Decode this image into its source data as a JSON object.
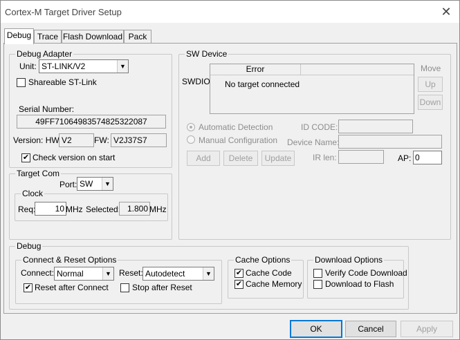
{
  "window": {
    "title": "Cortex-M Target Driver Setup",
    "close_glyph": "✕"
  },
  "tabs": [
    {
      "label": "Debug",
      "active": true
    },
    {
      "label": "Trace"
    },
    {
      "label": "Flash Download"
    },
    {
      "label": "Pack"
    }
  ],
  "debug_adapter": {
    "group_label": "Debug Adapter",
    "unit_label": "Unit:",
    "unit_value": "ST-LINK/V2",
    "shareable_label": "Shareable ST-Link",
    "shareable_checked": false,
    "serial_label": "Serial Number:",
    "serial_value": "49FF71064983574825322087",
    "version_label": "Version: HW:",
    "hw_value": "V2",
    "fw_label": "FW:",
    "fw_value": "V2J37S7",
    "check_version_label": "Check version on start",
    "check_version_checked": true
  },
  "target_com": {
    "group_label": "Target Com",
    "port_label": "Port:",
    "port_value": "SW",
    "clock_label": "Clock",
    "req_label": "Req:",
    "req_value": "10",
    "req_unit": "MHz",
    "selected_label": "Selected:",
    "selected_value": "1.800",
    "selected_unit": "MHz"
  },
  "sw_device": {
    "group_label": "SW Device",
    "swdio_label": "SWDIO",
    "col_error": "Error",
    "row_text": "No target connected",
    "move_label": "Move",
    "up_label": "Up",
    "down_label": "Down",
    "auto_detect_label": "Automatic Detection",
    "manual_config_label": "Manual Configuration",
    "id_code_label": "ID CODE:",
    "device_name_label": "Device Name:",
    "ir_len_label": "IR len:",
    "ap_label": "AP:",
    "ap_value": "0",
    "add_label": "Add",
    "delete_label": "Delete",
    "update_label": "Update"
  },
  "debug_section": {
    "group_label": "Debug",
    "connect_reset": {
      "group_label": "Connect & Reset Options",
      "connect_label": "Connect:",
      "connect_value": "Normal",
      "reset_label": "Reset:",
      "reset_value": "Autodetect",
      "reset_after_connect_label": "Reset after Connect",
      "reset_after_connect_checked": true,
      "stop_after_reset_label": "Stop after Reset",
      "stop_after_reset_checked": false
    },
    "cache": {
      "group_label": "Cache Options",
      "cache_code_label": "Cache Code",
      "cache_code_checked": true,
      "cache_memory_label": "Cache Memory",
      "cache_memory_checked": true
    },
    "download": {
      "group_label": "Download Options",
      "verify_label": "Verify Code Download",
      "verify_checked": false,
      "download_flash_label": "Download to Flash",
      "download_flash_checked": false
    }
  },
  "footer": {
    "ok_label": "OK",
    "cancel_label": "Cancel",
    "apply_label": "Apply"
  },
  "colors": {
    "window_bg": "#f0f0f0",
    "disabled_text": "#8d8d8d",
    "border": "#a0a0a0"
  }
}
